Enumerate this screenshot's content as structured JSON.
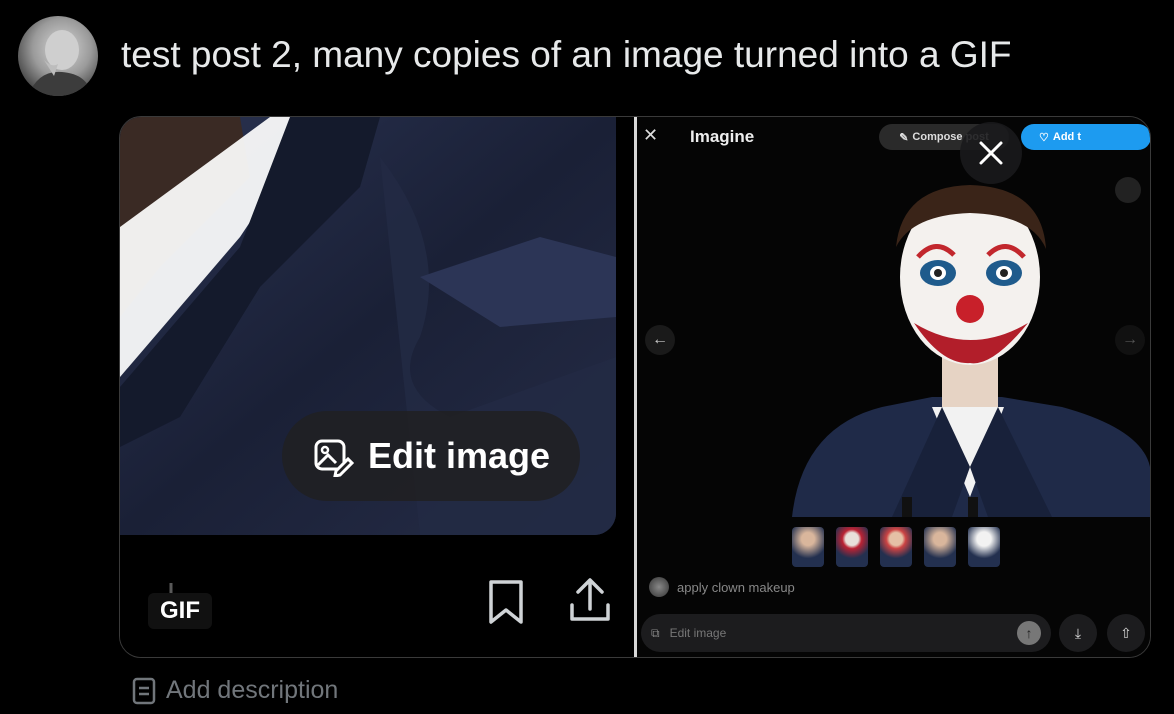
{
  "post": {
    "text": "test post 2, many copies of an image turned into a GIF"
  },
  "media": {
    "left": {
      "edit_button_label": "Edit image",
      "badge": "GIF"
    },
    "right": {
      "title": "Imagine",
      "compose_label": "Compose post",
      "add_label": "Add t",
      "prompt": "apply clown makeup",
      "input_placeholder": "Edit image"
    }
  },
  "footer": {
    "add_description_label": "Add description"
  },
  "colors": {
    "background": "#000000",
    "accent": "#1d9bf0",
    "muted_text": "#71767b"
  }
}
